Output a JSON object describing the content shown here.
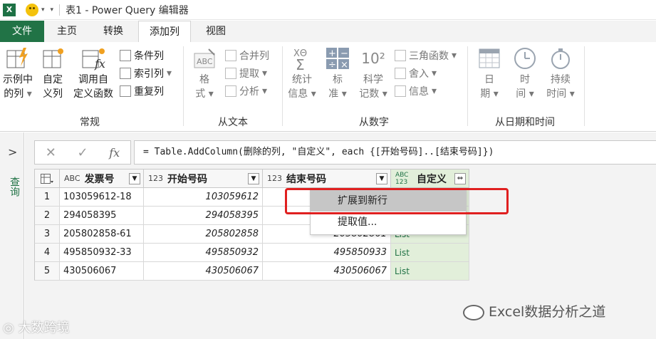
{
  "titlebar": {
    "app_icon": "X",
    "title": "表1 - Power Query 编辑器"
  },
  "tabs": [
    "文件",
    "主页",
    "转换",
    "添加列",
    "视图"
  ],
  "ribbon": {
    "general": {
      "example_col": [
        "示例中",
        "的列"
      ],
      "custom_col": [
        "自定",
        "义列"
      ],
      "invoke_func": [
        "调用自",
        "定义函数"
      ],
      "conditional": "条件列",
      "index": "索引列",
      "duplicate": "重复列",
      "label": "常规"
    },
    "text": {
      "format": [
        "格",
        "式"
      ],
      "merge": "合并列",
      "extract": "提取",
      "parse": "分析",
      "label": "从文本"
    },
    "number": {
      "stats": [
        "统计",
        "信息"
      ],
      "standard": [
        "标",
        "准"
      ],
      "scientific": [
        "科学",
        "记数"
      ],
      "trig": "三角函数",
      "rounding": "舍入",
      "info": "信息",
      "label": "从数字",
      "sci_icon": "10²"
    },
    "datetime": {
      "date": [
        "日",
        "期"
      ],
      "time": [
        "时",
        "间"
      ],
      "duration": [
        "持续",
        "时间"
      ],
      "label": "从日期和时间"
    }
  },
  "left_pane": {
    "label": "查询"
  },
  "formula_bar": {
    "fx": "fx",
    "formula": "= Table.AddColumn(删除的列, \"自定义\", each {[开始号码]..[结束号码]})"
  },
  "table": {
    "columns": [
      {
        "type": "ABC",
        "name": "发票号"
      },
      {
        "type": "123",
        "name": "开始号码"
      },
      {
        "type": "123",
        "name": "结束号码"
      },
      {
        "type": "ABC 123",
        "name": "自定义"
      }
    ],
    "rows": [
      {
        "n": "1",
        "invoice": "103059612-18",
        "start": "103059612",
        "end": "",
        "custom": ""
      },
      {
        "n": "2",
        "invoice": "294058395",
        "start": "294058395",
        "end": "",
        "custom": ""
      },
      {
        "n": "3",
        "invoice": "205802858-61",
        "start": "205802858",
        "end": "205802861",
        "custom": "List"
      },
      {
        "n": "4",
        "invoice": "495850932-33",
        "start": "495850932",
        "end": "495850933",
        "custom": "List"
      },
      {
        "n": "5",
        "invoice": "430506067",
        "start": "430506067",
        "end": "430506067",
        "custom": "List"
      }
    ]
  },
  "context_menu": {
    "items": [
      "扩展到新行",
      "提取值..."
    ]
  },
  "watermark": {
    "right": "Excel数据分析之道",
    "left": "大数跨境"
  },
  "colors": {
    "excel_green": "#217346",
    "highlight_red": "#e02020",
    "list_bg": "#e2efda"
  }
}
